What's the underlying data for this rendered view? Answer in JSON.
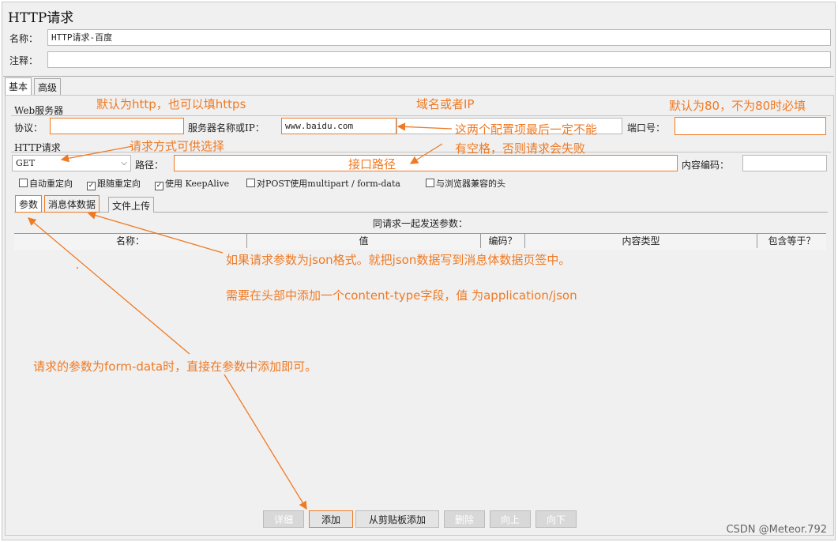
{
  "window": {
    "title": "HTTP请求"
  },
  "form": {
    "name_label": "名称：",
    "name_value": "HTTP请求-百度",
    "comment_label": "注释：",
    "comment_value": ""
  },
  "tabs": [
    {
      "label": "基本"
    },
    {
      "label": "高级"
    }
  ],
  "web_server": {
    "section_label": "Web服务器",
    "protocol_label": "协议：",
    "protocol_value": "",
    "server_label": "服务器名称或IP：",
    "server_value": "www.baidu.com",
    "port_label": "端口号：",
    "port_value": ""
  },
  "http_request": {
    "section_label": "HTTP请求",
    "method_value": "GET",
    "path_label": "路径：",
    "path_value": "",
    "encoding_label": "内容编码：",
    "encoding_value": ""
  },
  "options": [
    {
      "label": "自动重定向",
      "checked": false
    },
    {
      "label": "跟随重定向",
      "checked": true
    },
    {
      "label": "使用 KeepAlive",
      "checked": true
    },
    {
      "label": "对POST使用multipart / form-data",
      "checked": false
    },
    {
      "label": "与浏览器兼容的头",
      "checked": false
    }
  ],
  "sub_tabs": [
    {
      "label": "参数"
    },
    {
      "label": "消息体数据"
    },
    {
      "label": "文件上传"
    }
  ],
  "params_table": {
    "caption": "同请求一起发送参数：",
    "columns": [
      "名称：",
      "值",
      "编码？",
      "内容类型",
      "包含等于？"
    ]
  },
  "buttons": {
    "detail": "详细",
    "add": "添加",
    "add_clipboard": "从剪贴板添加",
    "delete": "删除",
    "up": "向上",
    "down": "向下"
  },
  "annotations": {
    "default_http": "默认为http，也可以填https",
    "domain_or_ip": "域名或者IP",
    "default_port": "默认为80，不为80时必填",
    "no_spaces_1": "这两个配置项最后一定不能",
    "no_spaces_2": "有空格，否则请求会失败",
    "method_select": "请求方式可供选择",
    "path": "接口路径",
    "json_body": "如果请求参数为json格式。就把json数据写到消息体数据页签中。",
    "content_type": "需要在头部中添加一个content-type字段，值 为application/json",
    "form_data": "请求的参数为form-data时，直接在参数中添加即可。"
  },
  "watermark": "CSDN @Meteor.792"
}
